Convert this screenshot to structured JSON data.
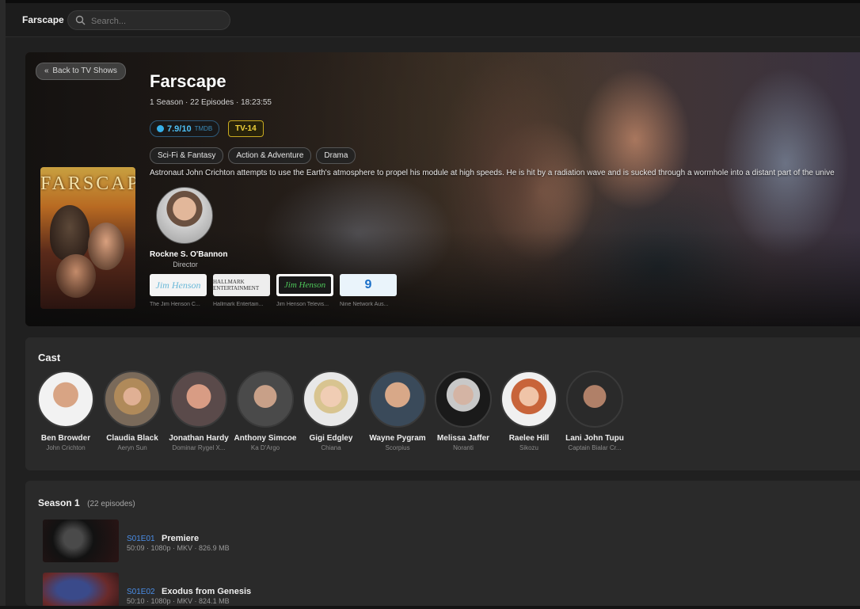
{
  "app": {
    "brand": "Farscape"
  },
  "search": {
    "placeholder": "Search..."
  },
  "hero": {
    "back_label": "Back to TV Shows",
    "title": "Farscape",
    "meta": "1 Season · 22 Episodes · 18:23:55",
    "rating": {
      "value": "7.9/10",
      "source": "TMDB"
    },
    "certification": "TV-14",
    "genres": [
      "Sci-Fi & Fantasy",
      "Action & Adventure",
      "Drama"
    ],
    "overview": "Astronaut John Crichton attempts to use the Earth's atmosphere to propel his module at high speeds. He is hit by a radiation wave and is sucked through a wormhole into a distant part of the unive",
    "poster_text": "FARSCAPE",
    "crew": {
      "name": "Rockne S. O'Bannon",
      "job": "Director"
    },
    "companies": [
      {
        "logo_text": "Jim Henson",
        "caption": "The Jim Henson C..."
      },
      {
        "logo_text": "HALLMARK ENTERTAINMENT",
        "caption": "Hallmark Entertain..."
      },
      {
        "logo_text": "Jim Henson",
        "caption": "Jim Henson Televis..."
      },
      {
        "logo_text": "9",
        "caption": "Nine Network Aus..."
      }
    ]
  },
  "cast": {
    "title": "Cast",
    "members": [
      {
        "name": "Ben Browder",
        "role": "John Crichton"
      },
      {
        "name": "Claudia Black",
        "role": "Aeryn Sun"
      },
      {
        "name": "Jonathan Hardy",
        "role": "Dominar Rygel X..."
      },
      {
        "name": "Anthony Simcoe",
        "role": "Ka D'Argo"
      },
      {
        "name": "Gigi Edgley",
        "role": "Chiana"
      },
      {
        "name": "Wayne Pygram",
        "role": "Scorpius"
      },
      {
        "name": "Melissa Jaffer",
        "role": "Noranti"
      },
      {
        "name": "Raelee Hill",
        "role": "Sikozu"
      },
      {
        "name": "Lani John Tupu",
        "role": "Captain Bialar Cr..."
      }
    ]
  },
  "season": {
    "title": "Season 1",
    "count": "(22 episodes)",
    "episodes": [
      {
        "code": "S01E01",
        "title": "Premiere",
        "meta": "50:09 · 1080p · MKV · 826.9 MB"
      },
      {
        "code": "S01E02",
        "title": "Exodus from Genesis",
        "meta": "50:10 · 1080p · MKV · 824.1 MB"
      }
    ]
  },
  "colors": {
    "accent": "#4a8ee8",
    "rating": "#4ec0f5",
    "certification": "#f0d23a",
    "background": "#202020",
    "panel": "#2a2a2a"
  }
}
